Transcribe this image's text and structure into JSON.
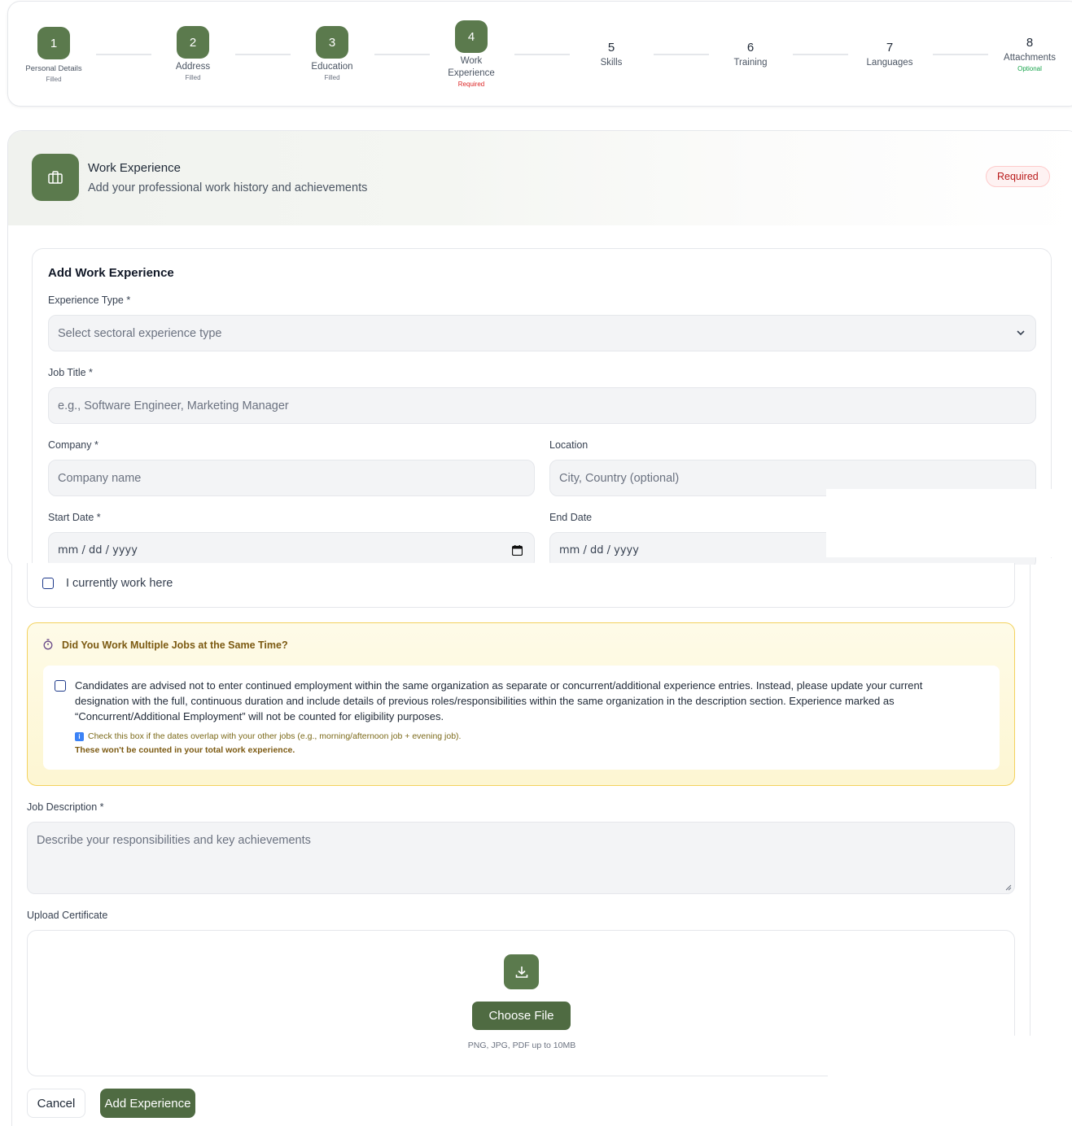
{
  "stepper": {
    "steps": [
      {
        "number": "1",
        "label": "Personal Details",
        "status": "Filled"
      },
      {
        "number": "2",
        "label": "Address",
        "status": "Filled"
      },
      {
        "number": "3",
        "label": "Education",
        "status": "Filled"
      },
      {
        "number": "4",
        "label": "Work Experience",
        "status": "Required"
      },
      {
        "number": "5",
        "label": "Skills",
        "status": ""
      },
      {
        "number": "6",
        "label": "Training",
        "status": ""
      },
      {
        "number": "7",
        "label": "Languages",
        "status": ""
      },
      {
        "number": "8",
        "label": "Attachments",
        "status": "Optional"
      }
    ],
    "active_step": "4"
  },
  "section": {
    "title": "Work Experience",
    "subtitle": "Add your professional work history and achievements",
    "badge": "Required",
    "icon": "briefcase-icon"
  },
  "form": {
    "title": "Add Work Experience",
    "experience_type": {
      "label": "Experience Type *",
      "placeholder": "Select sectoral experience type"
    },
    "job_title": {
      "label": "Job Title *",
      "placeholder": "e.g., Software Engineer, Marketing Manager"
    },
    "company": {
      "label": "Company *",
      "placeholder": "Company name"
    },
    "location": {
      "label": "Location",
      "placeholder": "City, Country (optional)"
    },
    "start_date": {
      "label": "Start Date *",
      "placeholder": "mm / dd / yyyy"
    },
    "end_date": {
      "label": "End Date",
      "placeholder": "mm / dd / yyyy"
    },
    "current_checkbox": {
      "label": "I currently work here",
      "checked": false
    }
  },
  "concurrent": {
    "title": "Did You Work Multiple Jobs at the Same Time?",
    "text": "Candidates are advised not to enter continued employment within the same organization as separate or concurrent/additional experience entries. Instead, please update your current designation with the full, continuous duration and include details of previous roles/responsibilities within the same organization in the description section. Experience marked as “Concurrent/Additional Employment” will not be counted for eligibility purposes.",
    "hint": "Check this box if the dates overlap with your other jobs (e.g., morning/afternoon job + evening job).",
    "note": "These won't be counted in your total work experience.",
    "checked": false
  },
  "description": {
    "label": "Job Description *",
    "placeholder": "Describe your responsibilities and key achievements"
  },
  "upload": {
    "label": "Upload Certificate",
    "button": "Choose File",
    "hint": "PNG, JPG, PDF up to 10MB"
  },
  "actions": {
    "cancel": "Cancel",
    "add": "Add Experience"
  },
  "colors": {
    "accent": "#5b7a4d",
    "required": "#dc2626",
    "optional": "#16a34a",
    "warning_border": "#f3d25e"
  }
}
